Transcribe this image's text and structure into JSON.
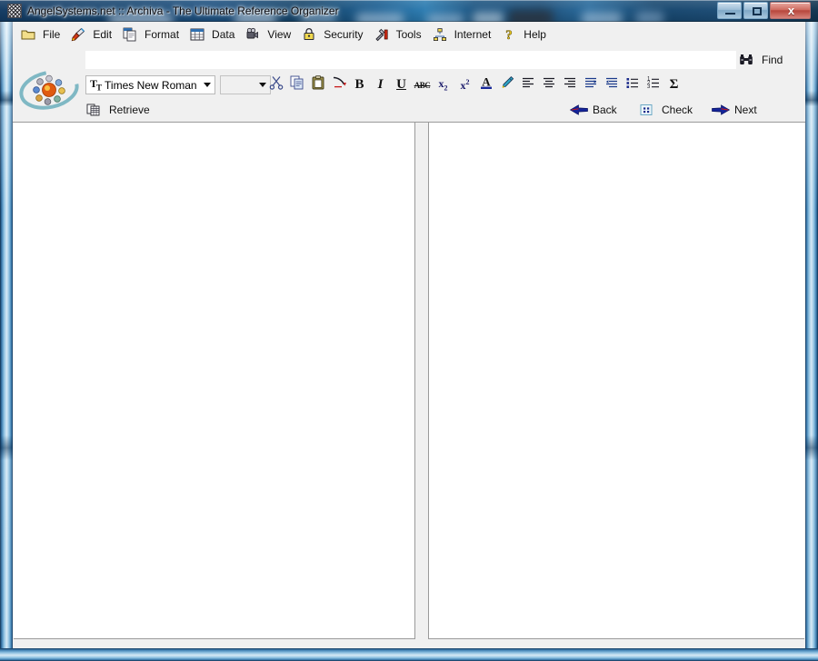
{
  "window": {
    "title": "AngelSystems.net :: Archiva - The Ultimate Reference Organizer",
    "app_icon": "archiva-app-icon",
    "controls": {
      "minimize_label": "",
      "maximize_label": "",
      "close_label": "x"
    },
    "colors": {
      "titlebar_blue": "#1d5080",
      "frame_blue": "#3d7db0",
      "client_gray": "#f0f0f0",
      "pane_white": "#ffffff",
      "pane_border": "#9a9a9a",
      "close_red": "#b7463c"
    }
  },
  "menu": {
    "items": [
      {
        "label": "File",
        "icon": "folder-icon"
      },
      {
        "label": "Edit",
        "icon": "paintbrush-icon"
      },
      {
        "label": "Format",
        "icon": "copy-pages-icon"
      },
      {
        "label": "Data",
        "icon": "table-grid-icon"
      },
      {
        "label": "View",
        "icon": "video-camera-icon"
      },
      {
        "label": "Security",
        "icon": "padlock-icon"
      },
      {
        "label": "Tools",
        "icon": "tools-hammer-icon"
      },
      {
        "label": "Internet",
        "icon": "network-tree-icon"
      },
      {
        "label": "Help",
        "icon": "question-key-icon"
      }
    ]
  },
  "search": {
    "value": "",
    "placeholder": "",
    "find_label": "Find",
    "find_icon": "binoculars-icon"
  },
  "format_toolbar": {
    "font_name": {
      "value": "Times New Roman",
      "icon": "truetype-icon",
      "arrow_icon": "chevron-down-icon"
    },
    "font_size": {
      "value": "",
      "arrow_icon": "chevron-down-icon"
    },
    "buttons": [
      {
        "icon": "cut-scissors-icon",
        "label": "Cut"
      },
      {
        "icon": "copy-icon",
        "label": "Copy"
      },
      {
        "icon": "paste-clipboard-icon",
        "label": "Paste"
      },
      {
        "icon": "undo-arrow-icon",
        "label": "Undo"
      },
      {
        "icon": "bold-icon",
        "label": "B"
      },
      {
        "icon": "italic-icon",
        "label": "I"
      },
      {
        "icon": "underline-icon",
        "label": "U"
      },
      {
        "icon": "strikethrough-abc-icon",
        "label": "ABC"
      },
      {
        "icon": "subscript-icon",
        "label": "x2"
      },
      {
        "icon": "superscript-icon",
        "label": "x2"
      },
      {
        "icon": "font-color-icon",
        "label": "A"
      },
      {
        "icon": "highlighter-pen-icon",
        "label": "Highlight"
      },
      {
        "icon": "align-left-icon",
        "label": "Align Left"
      },
      {
        "icon": "align-center-icon",
        "label": "Align Center"
      },
      {
        "icon": "align-right-icon",
        "label": "Align Right"
      },
      {
        "icon": "align-justify-icon",
        "label": "Justify"
      },
      {
        "icon": "decrease-indent-icon",
        "label": "Decrease Indent"
      },
      {
        "icon": "increase-indent-icon",
        "label": "Increase Indent"
      },
      {
        "icon": "bulleted-list-icon",
        "label": "Bullets"
      },
      {
        "icon": "numbered-list-icon",
        "label": "Numbering"
      },
      {
        "icon": "sigma-sum-icon",
        "label": "Sum"
      }
    ]
  },
  "action_toolbar": {
    "retrieve": {
      "label": "Retrieve",
      "icon": "retrieve-database-icon"
    },
    "back": {
      "label": "Back",
      "icon": "arrow-left-icon"
    },
    "check": {
      "label": "Check",
      "icon": "check-grid-icon"
    },
    "next": {
      "label": "Next",
      "icon": "arrow-right-icon"
    }
  },
  "logo": {
    "name": "angelsystems-atom-logo",
    "ring_color": "#7fb8c4",
    "core_color": "#d8380c"
  },
  "panes": {
    "left": {
      "name": "document-pane-left",
      "content": ""
    },
    "right": {
      "name": "document-pane-right",
      "content": ""
    }
  }
}
